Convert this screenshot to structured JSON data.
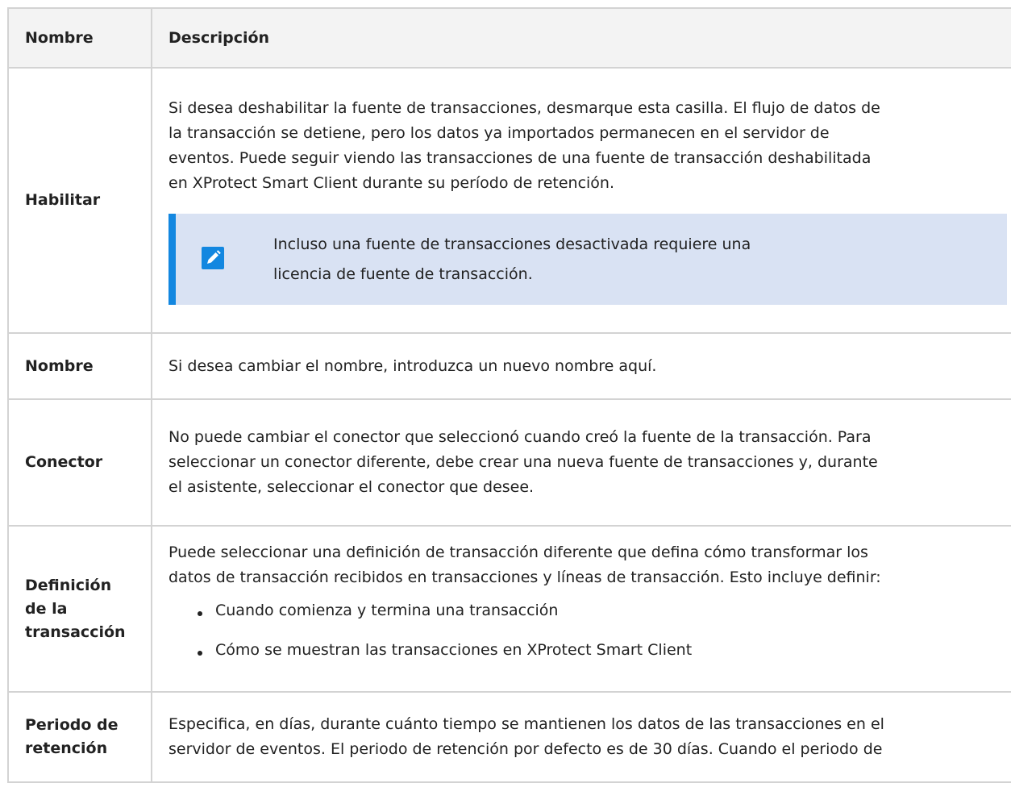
{
  "table": {
    "headers": {
      "name": "Nombre",
      "description": "Descripción"
    },
    "rows": [
      {
        "name": "Habilitar",
        "description": "Si desea deshabilitar la fuente de transacciones, desmarque esta casilla. El flujo de datos de la transacción se detiene, pero los datos ya importados permanecen en el servidor de eventos. Puede seguir viendo las transacciones de una fuente de transacción deshabilitada en XProtect Smart Client durante su período de retención.",
        "description_lines": [
          "Si desea deshabilitar la fuente de transacciones, desmarque esta casilla. El flujo de datos de",
          "la transacción se detiene, pero los datos ya importados permanecen en el servidor de",
          "eventos. Puede seguir viendo las transacciones de una fuente de transacción deshabilitada",
          "en XProtect Smart Client durante su período de retención."
        ],
        "note": {
          "icon": "pencil-note-icon",
          "lines": [
            "Incluso una fuente de transacciones desactivada requiere una",
            "licencia de fuente de transacción."
          ]
        }
      },
      {
        "name": "Nombre",
        "description_lines": [
          "Si desea cambiar el nombre, introduzca un nuevo nombre aquí."
        ]
      },
      {
        "name": "Conector",
        "description_lines": [
          "No puede cambiar el conector que seleccionó cuando creó la fuente de la transacción. Para",
          "seleccionar un conector diferente, debe crear una nueva fuente de transacciones y, durante",
          "el asistente, seleccionar el conector que desee."
        ]
      },
      {
        "name_lines": [
          "Definición",
          "de la",
          "transacción"
        ],
        "description_lines": [
          "Puede seleccionar una definición de transacción diferente que defina cómo transformar los",
          "datos de transacción recibidos en transacciones y líneas de transacción. Esto incluye definir:"
        ],
        "bullets": [
          "Cuando comienza y termina una transacción",
          "Cómo se muestran las transacciones en XProtect Smart Client"
        ]
      },
      {
        "name_lines": [
          "Periodo de",
          "retención"
        ],
        "description_lines": [
          "Especifica, en días, durante cuánto tiempo se mantienen los datos de las transacciones en el",
          "servidor de eventos. El periodo de retención por defecto es de 30 días. Cuando el periodo de"
        ]
      }
    ]
  },
  "colors": {
    "note_background": "#d9e2f3",
    "note_accent": "#1387e0",
    "header_background": "#f3f3f3",
    "border": "#d3d3d3"
  }
}
